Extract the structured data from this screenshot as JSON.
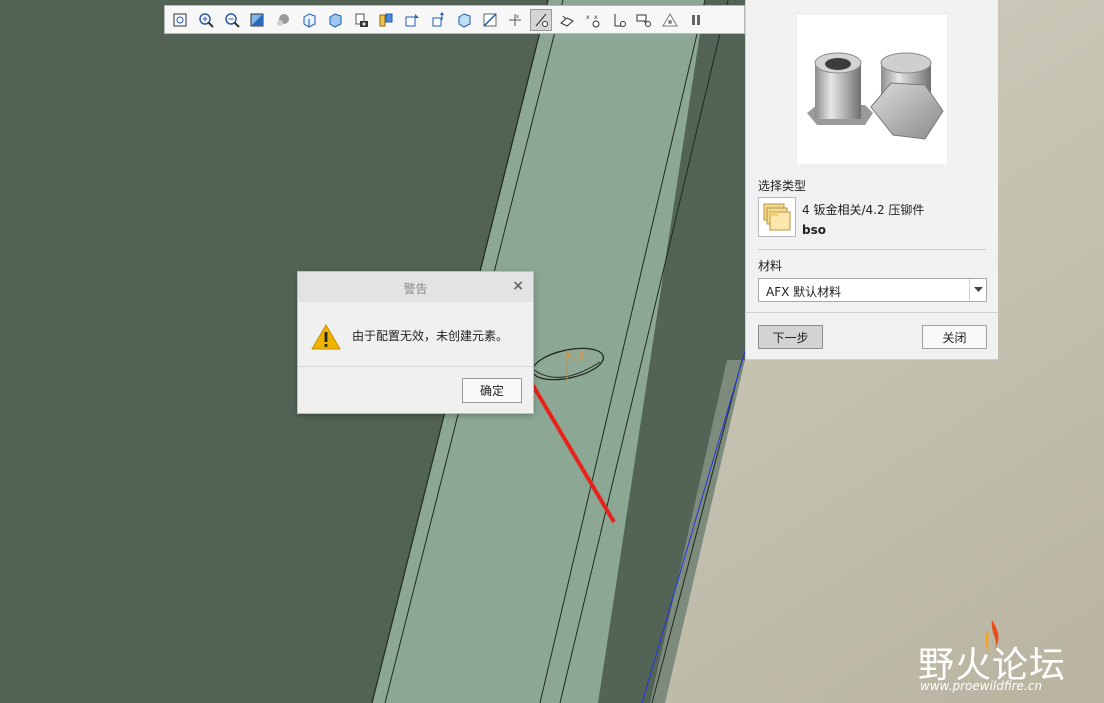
{
  "toolbar": {
    "buttons": [
      {
        "icon": "zoom-fit-icon"
      },
      {
        "icon": "zoom-in-icon"
      },
      {
        "icon": "zoom-out-icon"
      },
      {
        "icon": "repaint-icon"
      },
      {
        "icon": "display-style-icon"
      },
      {
        "icon": "saved-orientation-icon"
      },
      {
        "icon": "view-manager-icon"
      },
      {
        "icon": "camera-icon"
      },
      {
        "icon": "named-view-icon"
      },
      {
        "icon": "datum-display-icon"
      },
      {
        "icon": "plane-display-icon"
      },
      {
        "icon": "axis-display-icon"
      },
      {
        "icon": "point-display-icon"
      },
      {
        "icon": "csys-display-icon"
      },
      {
        "icon": "annotation-display-icon",
        "active": true
      },
      {
        "icon": "spin-center-icon"
      },
      {
        "icon": "annotation-tag-icon"
      },
      {
        "icon": "note-icon"
      },
      {
        "icon": "connection-icon"
      },
      {
        "icon": "triangle-display-icon"
      },
      {
        "icon": "pause-icon"
      }
    ]
  },
  "panel": {
    "thumbnail": "pem-nut-icon",
    "type_label": "选择类型",
    "type_path": "4 钣金相关/4.2 压铆件",
    "type_code": "bso",
    "material_label": "材料",
    "material_value": "AFX 默认材料",
    "next_button": "下一步",
    "close_button": "关闭"
  },
  "dialog": {
    "title": "警告",
    "close_symbol": "×",
    "icon": "warning-icon",
    "message": "由于配置无效，未创建元素。",
    "ok_button": "确定"
  },
  "annotation": {
    "hole_label": "A_3"
  },
  "watermark": {
    "title_left": "野",
    "title_mid": "火",
    "title_right": "论坛",
    "url": "www.proewildfire.cn"
  },
  "colors": {
    "model_dark": "#516255",
    "model_light": "#8aa693",
    "background": "#c6c4b4",
    "arrow": "#e8231b",
    "warning": "#f0b400"
  }
}
